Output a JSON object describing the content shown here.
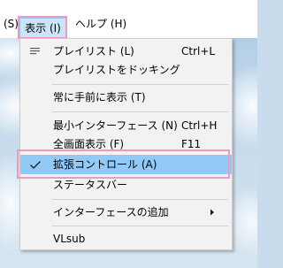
{
  "menubar": {
    "prev_label": "(S)",
    "view_label": "表示 (I)",
    "help_label": "ヘルプ (H)"
  },
  "view_menu": {
    "items": [
      {
        "label": "プレイリスト (L)",
        "shortcut": "Ctrl+L",
        "icon": "playlist-icon"
      },
      {
        "label": "プレイリストをドッキング",
        "shortcut": ""
      },
      {
        "label": "常に手前に表示 (T)",
        "shortcut": ""
      },
      {
        "label": "最小インターフェース (N)",
        "shortcut": "Ctrl+H"
      },
      {
        "label": "全画面表示 (F)",
        "shortcut": "F11"
      },
      {
        "label": "拡張コントロール (A)",
        "shortcut": "",
        "checked": true,
        "highlighted": true
      },
      {
        "label": "ステータスバー",
        "shortcut": ""
      },
      {
        "label": "インターフェースの追加",
        "shortcut": "",
        "submenu": true
      },
      {
        "label": "VLsub",
        "shortcut": ""
      }
    ]
  },
  "colors": {
    "annotation": "#ec9bbf",
    "hover": "#91c9f7",
    "menu_bg": "#f2f2f2"
  }
}
